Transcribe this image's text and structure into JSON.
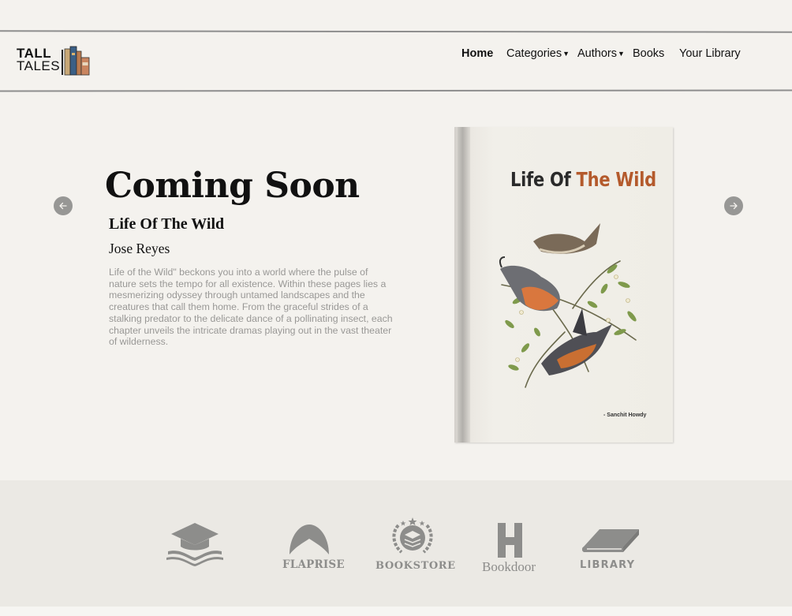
{
  "brand": {
    "line1": "TALL",
    "line2": "TALES"
  },
  "nav": {
    "items": [
      {
        "label": "Home",
        "active": true
      },
      {
        "label": "Categories",
        "dropdown": true
      },
      {
        "label": "Authors",
        "dropdown": true
      },
      {
        "label": "Books"
      },
      {
        "label": "Your Library"
      }
    ]
  },
  "hero": {
    "heading": "Coming Soon",
    "book_title": "Life Of The Wild",
    "author": "Jose Reyes",
    "description": "Life of the Wild\" beckons you into a world where the pulse of nature sets the tempo for all existence. Within these pages lies a mesmerizing odyssey through untamed landscapes and the creatures that call them home. From the graceful strides of a stalking predator to the delicate dance of a pollinating insect, each chapter unveils the intricate dramas playing out in the vast theater of wilderness."
  },
  "cover": {
    "title_part1": "Life Of ",
    "title_part2": "The Wild",
    "author": "- Sanchit Howdy",
    "accent_color": "#b45a2c"
  },
  "partners": [
    {
      "icon": "graduation-cap-books-icon",
      "label": ""
    },
    {
      "icon": "flaprise-leaf-icon",
      "label": "FLAPRISE"
    },
    {
      "icon": "bookstore-laurel-icon",
      "label": "BOOKSTORE"
    },
    {
      "icon": "bookdoor-h-icon",
      "label": "Bookdoor"
    },
    {
      "icon": "library-book-icon",
      "label": "LIBRARY"
    }
  ],
  "colors": {
    "background": "#f4f2ee",
    "partner_band": "#ebe9e4",
    "muted_text": "#999896",
    "partner_gray": "#8d8d8b"
  }
}
